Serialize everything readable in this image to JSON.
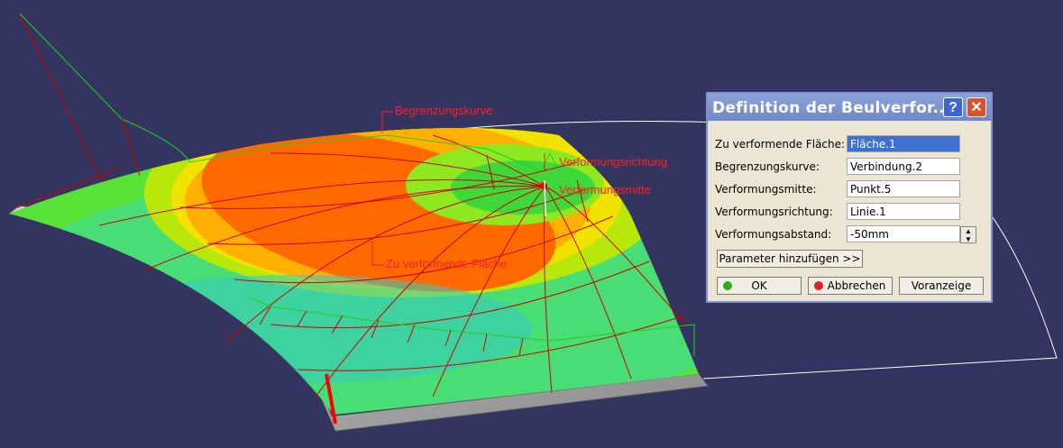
{
  "viewport": {
    "labels": {
      "begrenzungskurve": "Begrenzungskurve",
      "verformungsrichtung": "Verformungsrichtung",
      "verformungsmitte": "Verformungsmitte",
      "zu_verformende_flaeche": "Zu verformende Fläche"
    },
    "colors": {
      "background": "#33345f",
      "annotation": "#ff2020"
    }
  },
  "dialog": {
    "title": "Definition der Beulverfor...",
    "help_label": "?",
    "close_label": "✕",
    "fields": [
      {
        "label": "Zu verformende Fläche:",
        "value": "Fläche.1"
      },
      {
        "label": "Begrenzungskurve:",
        "value": "Verbindung.2"
      },
      {
        "label": "Verformungsmitte:",
        "value": "Punkt.5"
      },
      {
        "label": "Verformungsrichtung:",
        "value": "Linie.1"
      },
      {
        "label": "Verformungsabstand:",
        "value": "-50mm"
      }
    ],
    "params_button": "Parameter hinzufügen >>",
    "ok_button": "OK",
    "cancel_button": "Abbrechen",
    "preview_button": "Voranzeige"
  }
}
